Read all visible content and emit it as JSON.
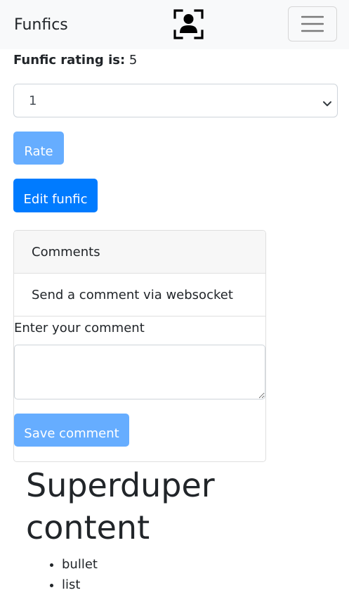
{
  "navbar": {
    "brand": "Funfics",
    "profile_icon": "user-profile-scan-icon",
    "toggler_icon": "hamburger-menu-icon"
  },
  "rating": {
    "label": "Funfic rating is:",
    "value": "5"
  },
  "rating_select": {
    "selected": "1",
    "icon": "chevron-down-icon"
  },
  "buttons": {
    "rate": "Rate",
    "edit": "Edit funfic"
  },
  "comments": {
    "header": "Comments",
    "subheader": "Send a comment via websocket",
    "input_label": "Enter your comment",
    "input_value": "",
    "save_label": "Save comment"
  },
  "content": {
    "heading": "Superduper content",
    "bullets": [
      "bullet",
      "list"
    ]
  },
  "colors": {
    "primary": "#007bff",
    "primary_disabled": "#66adff",
    "navbar_bg": "#f8f9fa"
  }
}
